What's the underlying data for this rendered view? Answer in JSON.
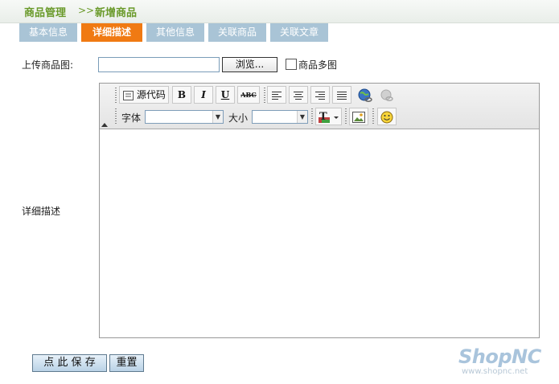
{
  "breadcrumb": {
    "section": "商品管理",
    "separator": ">>",
    "current": "新增商品"
  },
  "tabs": [
    {
      "label": "基本信息",
      "active": false
    },
    {
      "label": "详细描述",
      "active": true
    },
    {
      "label": "其他信息",
      "active": false
    },
    {
      "label": "关联商品",
      "active": false
    },
    {
      "label": "关联文章",
      "active": false
    }
  ],
  "upload": {
    "label": "上传商品图:",
    "value": "",
    "browse_label": "浏览...",
    "multi_label": "商品多图",
    "multi_checked": false
  },
  "editor": {
    "label": "详细描述",
    "source_label": "源代码",
    "bold": "B",
    "italic": "I",
    "underline": "U",
    "strike": "ABC",
    "font_label": "字体",
    "font_value": "",
    "size_label": "大小",
    "size_value": "",
    "text_color_glyph": "T",
    "content": ""
  },
  "actions": {
    "save_label": "点 此 保 存",
    "reset_label": "重置"
  },
  "brand": {
    "logo": "ShopNC",
    "url": "www.shopnc.net"
  },
  "colors": {
    "active_tab": "#f07a13",
    "tab": "#a9c4d6",
    "title": "#6a9a2a"
  }
}
